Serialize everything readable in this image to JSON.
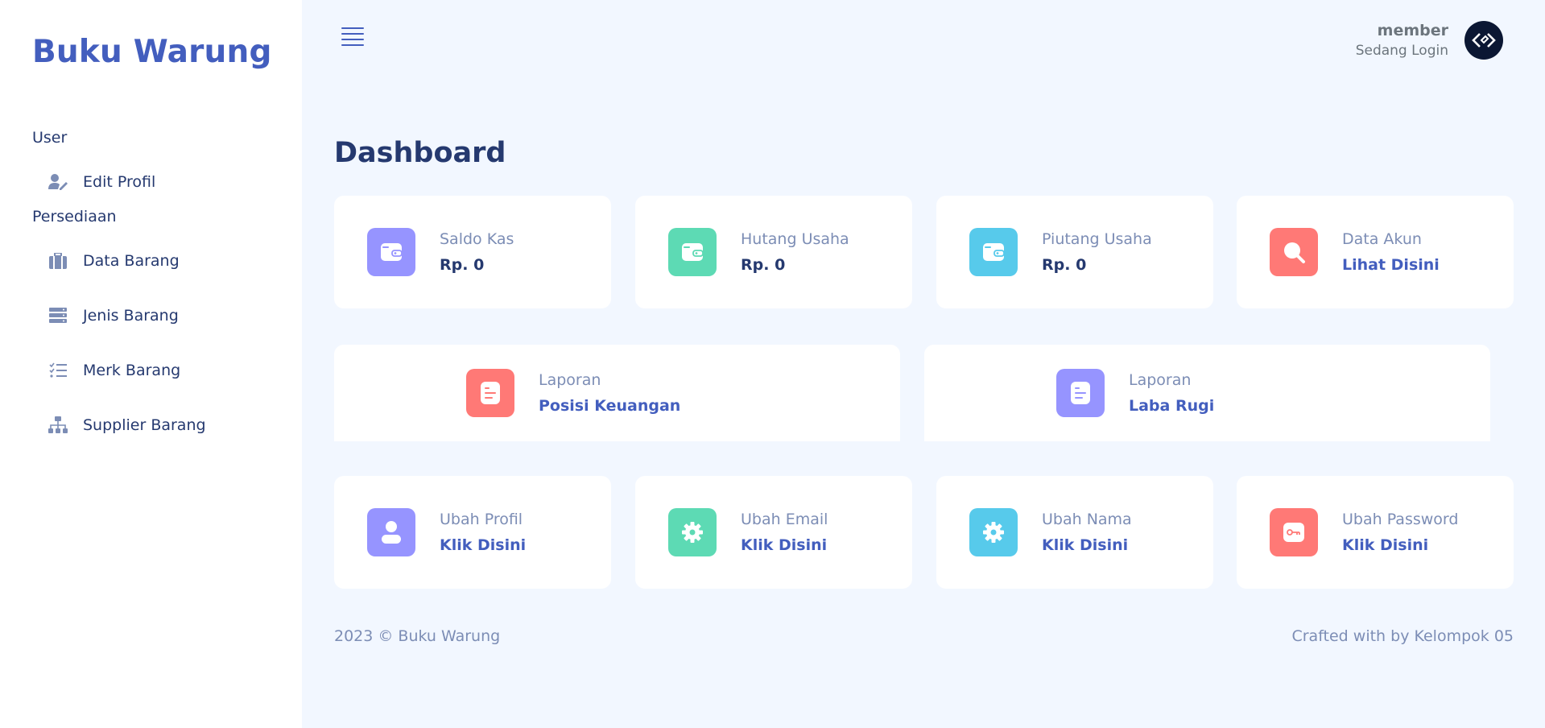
{
  "sidebar": {
    "brand": "Buku Warung",
    "sections": [
      {
        "title": "User"
      },
      {
        "title": "Persediaan"
      }
    ],
    "items": [
      {
        "label": "Edit Profil",
        "icon": "user-edit-icon"
      },
      {
        "label": "Data Barang",
        "icon": "briefcase-icon"
      },
      {
        "label": "Jenis Barang",
        "icon": "server-icon"
      },
      {
        "label": "Merk Barang",
        "icon": "list-check-icon"
      },
      {
        "label": "Supplier Barang",
        "icon": "sitemap-icon"
      }
    ]
  },
  "header": {
    "user_name": "member",
    "user_status": "Sedang Login"
  },
  "main": {
    "title": "Dashboard",
    "stats": [
      {
        "label": "Saldo Kas",
        "value": "Rp. 0",
        "icon": "wallet-icon",
        "color": "#9694ff"
      },
      {
        "label": "Hutang Usaha",
        "value": "Rp. 0",
        "icon": "wallet-icon",
        "color": "#5ddab4"
      },
      {
        "label": "Piutang Usaha",
        "value": "Rp. 0",
        "icon": "wallet-icon",
        "color": "#57caeb"
      },
      {
        "label": "Data Akun",
        "value": "Lihat Disini",
        "icon": "search-icon",
        "color": "#ff7976"
      }
    ],
    "reports": [
      {
        "label": "Laporan",
        "value": "Posisi Keuangan",
        "icon": "document-icon",
        "color": "#ff7976"
      },
      {
        "label": "Laporan",
        "value": "Laba Rugi",
        "icon": "document-icon",
        "color": "#9694ff"
      }
    ],
    "settings": [
      {
        "label": "Ubah Profil",
        "value": "Klik Disini",
        "icon": "user-icon",
        "color": "#9694ff"
      },
      {
        "label": "Ubah Email",
        "value": "Klik Disini",
        "icon": "gear-icon",
        "color": "#5ddab4"
      },
      {
        "label": "Ubah Nama",
        "value": "Klik Disini",
        "icon": "gear-icon",
        "color": "#57caeb"
      },
      {
        "label": "Ubah Password",
        "value": "Klik Disini",
        "icon": "key-icon",
        "color": "#ff7976"
      }
    ]
  },
  "footer": {
    "left": "2023 © Buku Warung",
    "right": "Crafted with by Kelompok 05"
  }
}
